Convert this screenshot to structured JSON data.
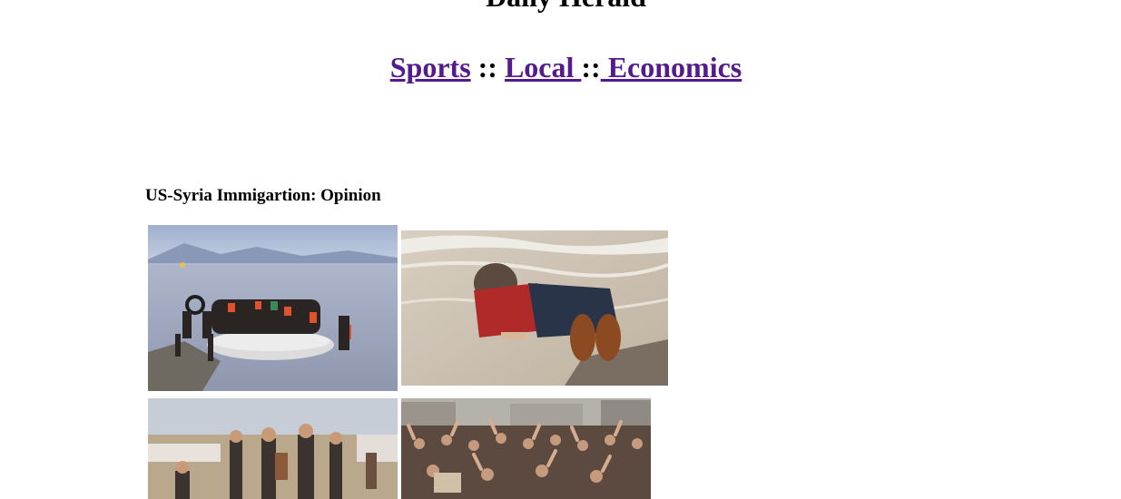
{
  "header": {
    "site_title": "Daily Herald"
  },
  "nav": {
    "items": [
      {
        "label": "Sports"
      },
      {
        "label": "Local "
      },
      {
        "label": " Economics"
      }
    ],
    "separator": "::"
  },
  "article": {
    "title": "US-Syria Immigartion: Opinion"
  },
  "images": [
    {
      "icon": "refugee-boat-photo"
    },
    {
      "icon": "child-on-beach-photo"
    },
    {
      "icon": "refugee-camp-children-photo"
    },
    {
      "icon": "protest-crowd-photo"
    }
  ],
  "colors": {
    "link": "#551a8b",
    "text": "#000000",
    "background": "#ffffff"
  }
}
